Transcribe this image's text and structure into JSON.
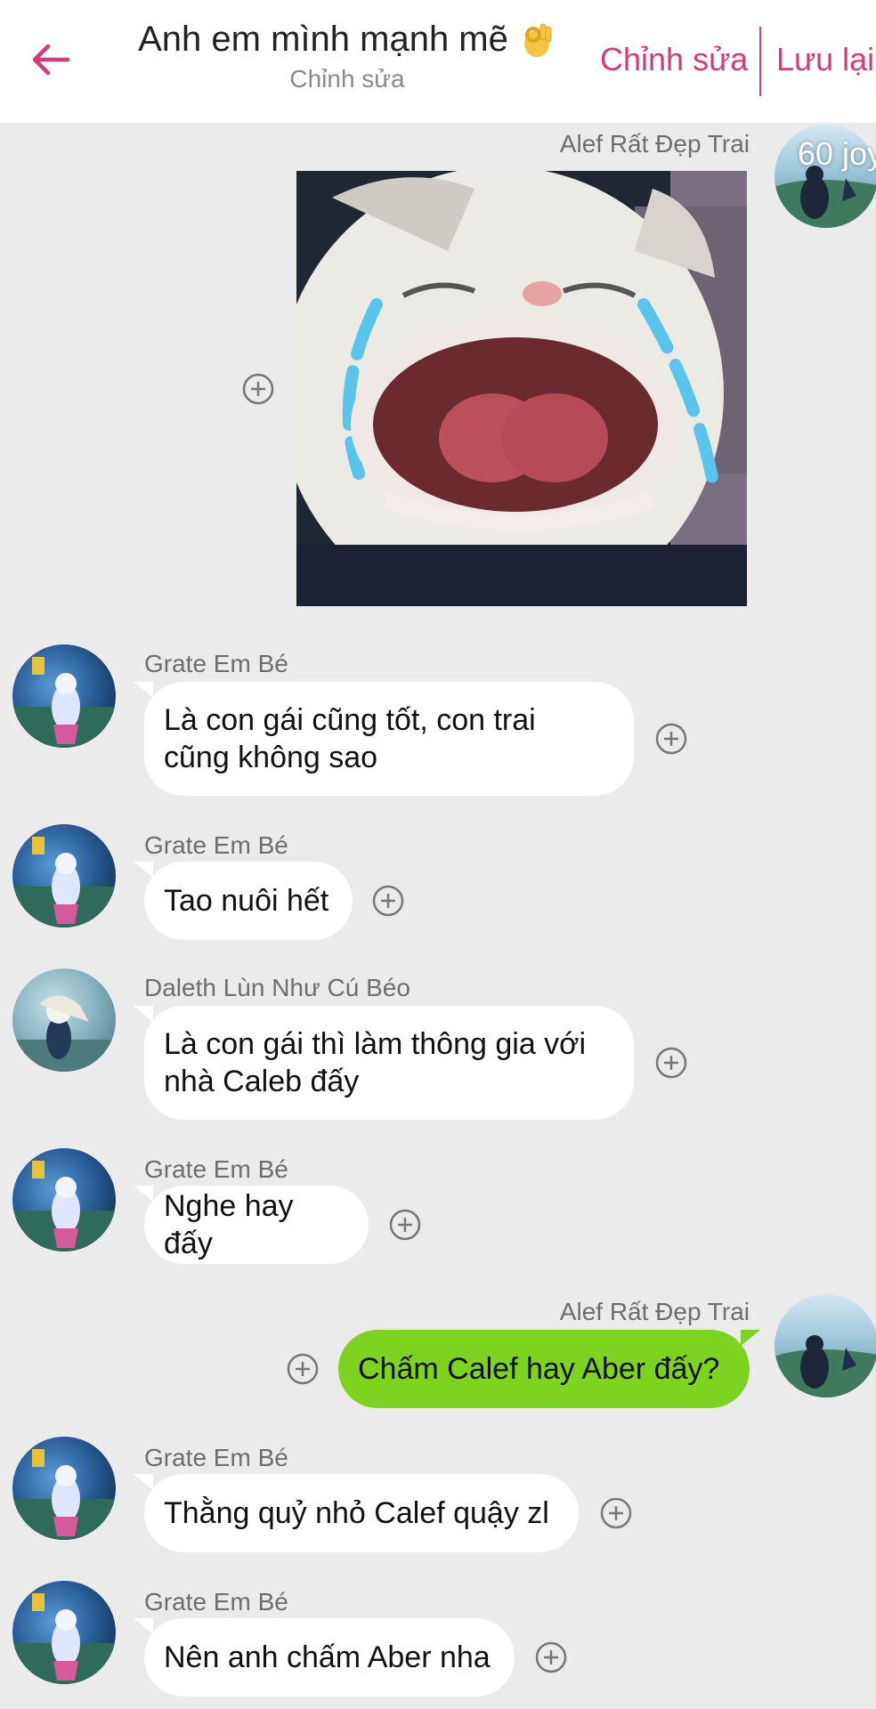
{
  "header": {
    "title": "Anh em mình mạnh mẽ",
    "subtitle": "Chỉnh sửa",
    "edit_label": "Chỉnh sửa",
    "save_label": "Lưu lại",
    "accent_color": "#d63a7a",
    "icons": [
      "back-arrow-icon",
      "ok-hand-emoji-icon"
    ]
  },
  "messages": [
    {
      "sender": "Alef Rất Đẹp Trai",
      "side": "right",
      "type": "image",
      "image": "crying-cat-photo",
      "avatar_badge": "60 joy"
    },
    {
      "sender": "Grate Em Bé",
      "side": "left",
      "lines": [
        "Là con gái cũng tốt, con trai",
        "cũng không sao"
      ]
    },
    {
      "sender": "Grate Em Bé",
      "side": "left",
      "lines": [
        "Tao nuôi hết"
      ]
    },
    {
      "sender": "Daleth Lùn Như Cú Béo",
      "side": "left",
      "lines": [
        "Là con gái thì làm thông gia với",
        "nhà Caleb đấy"
      ]
    },
    {
      "sender": "Grate Em Bé",
      "side": "left",
      "lines": [
        "Nghe hay đấy"
      ]
    },
    {
      "sender": "Alef Rất Đẹp Trai",
      "side": "right",
      "lines": [
        "Chấm Calef hay Aber đấy?"
      ],
      "bubble_color": "#7ed321"
    },
    {
      "sender": "Grate Em Bé",
      "side": "left",
      "lines": [
        "Thằng quỷ nhỏ Calef quậy zl"
      ]
    },
    {
      "sender": "Grate Em Bé",
      "side": "left",
      "lines": [
        "Nên anh chấm Aber nha"
      ]
    }
  ]
}
